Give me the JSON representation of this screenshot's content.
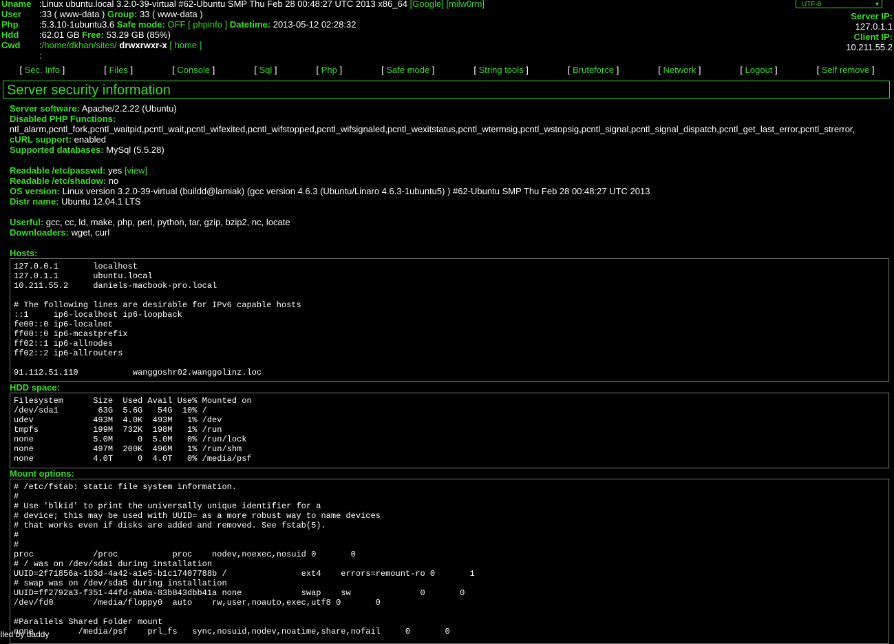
{
  "header": {
    "uname_label": "Uname",
    "uname_value": ":Linux ubuntu.local 3.2.0-39-virtual #62-Ubuntu SMP Thu Feb 28 00:48:27 UTC 2013 x86_64",
    "google_link": "[Google]",
    "milw0rm_link": "[milw0rm]",
    "user_label": "User",
    "user_value": ":33 ( www-data )",
    "group_label": "Group:",
    "group_value": "33 ( www-data )",
    "php_label": "Php",
    "php_value": ":5.3.10-1ubuntu3.6",
    "safe_mode_label": "Safe mode:",
    "safe_mode_value": "OFF",
    "phpinfo_link": "[ phpinfo ]",
    "datetime_label": "Datetime:",
    "datetime_value": "2013-05-12 02:28:32",
    "hdd_label": "Hdd",
    "hdd_value": ":62.01 GB",
    "free_label": "Free:",
    "free_value": "53.29 GB (85%)",
    "cwd_label": "Cwd",
    "cwd_prefix": ":",
    "cwd_path": "/home/dkhan/sites/",
    "cwd_perms": "drwxrwxr-x",
    "home_link": "[ home ]",
    "extra_line": ":"
  },
  "encoding": {
    "value": "UTF-8",
    "arrow": "▾"
  },
  "ips": {
    "server_label": "Server IP:",
    "server_value": "127.0.1.1",
    "client_label": "Client IP:",
    "client_value": "10.211.55.2"
  },
  "menu": [
    {
      "label": "Sec. Info"
    },
    {
      "label": "Files"
    },
    {
      "label": "Console"
    },
    {
      "label": "Sql"
    },
    {
      "label": "Php"
    },
    {
      "label": "Safe mode"
    },
    {
      "label": "String tools"
    },
    {
      "label": "Bruteforce"
    },
    {
      "label": "Network"
    },
    {
      "label": "Logout"
    },
    {
      "label": "Self remove"
    }
  ],
  "section_title": "Server security information",
  "info": {
    "server_software_label": "Server software:",
    "server_software_value": "Apache/2.2.22 (Ubuntu)",
    "disabled_label": "Disabled PHP Functions:",
    "disabled_value": "pcntl_alarm,pcntl_fork,pcntl_waitpid,pcntl_wait,pcntl_wifexited,pcntl_wifstopped,pcntl_wifsignaled,pcntl_wexitstatus,pcntl_wtermsig,pcntl_wstopsig,pcntl_signal,pcntl_signal_dispatch,pcntl_get_last_error,pcntl_strerror,",
    "curl_label": "cURL support:",
    "curl_value": "enabled",
    "db_label": "Supported databases:",
    "db_value": "MySql (5.5.28)",
    "passwd_label": "Readable /etc/passwd:",
    "passwd_value": "yes",
    "passwd_view": "[view]",
    "shadow_label": "Readable /etc/shadow:",
    "shadow_value": "no",
    "os_label": "OS version:",
    "os_value": "Linux version 3.2.0-39-virtual (buildd@lamiak) (gcc version 4.6.3 (Ubuntu/Linaro 4.6.3-1ubuntu5) ) #62-Ubuntu SMP Thu Feb 28 00:48:27 UTC 2013",
    "distr_label": "Distr name:",
    "distr_value": "Ubuntu 12.04.1 LTS",
    "userful_label": "Userful:",
    "userful_value": "gcc, cc, ld, make, php, perl, python, tar, gzip, bzip2, nc, locate",
    "downloaders_label": "Downloaders:",
    "downloaders_value": "wget, curl"
  },
  "hosts": {
    "label": "Hosts:",
    "content": "127.0.0.1       localhost\n127.0.1.1       ubuntu.local\n10.211.55.2     daniels-macbook-pro.local\n\n# The following lines are desirable for IPv6 capable hosts\n::1     ip6-localhost ip6-loopback\nfe00::0 ip6-localnet\nff00::0 ip6-mcastprefix\nff02::1 ip6-allnodes\nff02::2 ip6-allrouters\n\n91.112.51.110           wanggoshr02.wanggolinz.loc"
  },
  "hdd": {
    "label": "HDD space:",
    "content": "Filesystem      Size  Used Avail Use% Mounted on\n/dev/sda1        63G  5.6G   54G  10% /\nudev            493M  4.0K  493M   1% /dev\ntmpfs           199M  732K  198M   1% /run\nnone            5.0M     0  5.0M   0% /run/lock\nnone            497M  200K  496M   1% /run/shm\nnone            4.0T     0  4.0T   0% /media/psf"
  },
  "mount": {
    "label": "Mount options:",
    "content": "# /etc/fstab: static file system information.\n#\n# Use 'blkid' to print the universally unique identifier for a\n# device; this may be used with UUID= as a more robust way to name devices\n# that works even if disks are added and removed. See fstab(5).\n#\n#\nproc            /proc           proc    nodev,noexec,nosuid 0       0\n# / was on /dev/sda1 during installation\nUUID=2f71856a-1b3d-4a42-a1e5-b1c17407788b /               ext4    errors=remount-ro 0       1\n# swap was on /dev/sda5 during installation\nUUID=ff2792a3-f351-44fd-ab0a-83b843dbb41a none            swap    sw              0       0\n/dev/fd0        /media/floppy0  auto    rw,user,noauto,exec,utf8 0       0\n\n#Parallels Shared Folder mount\nnone         /media/psf    prl_fs   sync,nosuid,nodev,noatime,share,nofail     0       0"
  },
  "footer": "elled by daddy"
}
